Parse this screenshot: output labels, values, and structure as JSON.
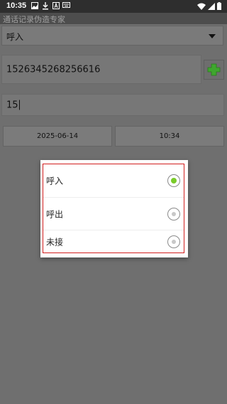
{
  "status_bar": {
    "time": "10:35"
  },
  "app": {
    "title": "通话记录伪造专家"
  },
  "call_type": {
    "selected": "呼入"
  },
  "phone": {
    "value": "1526345268256616"
  },
  "duration": {
    "value": "15"
  },
  "date_button": {
    "label": "2025-06-14"
  },
  "time_button": {
    "label": "10:34"
  },
  "dialog": {
    "options": [
      {
        "label": "呼入",
        "selected": true
      },
      {
        "label": "呼出",
        "selected": false
      },
      {
        "label": "未接",
        "selected": false
      }
    ]
  },
  "colors": {
    "accent_green": "#7acb2a",
    "dialog_border": "#d21e1e",
    "status_bar": "#2e2e2e"
  }
}
